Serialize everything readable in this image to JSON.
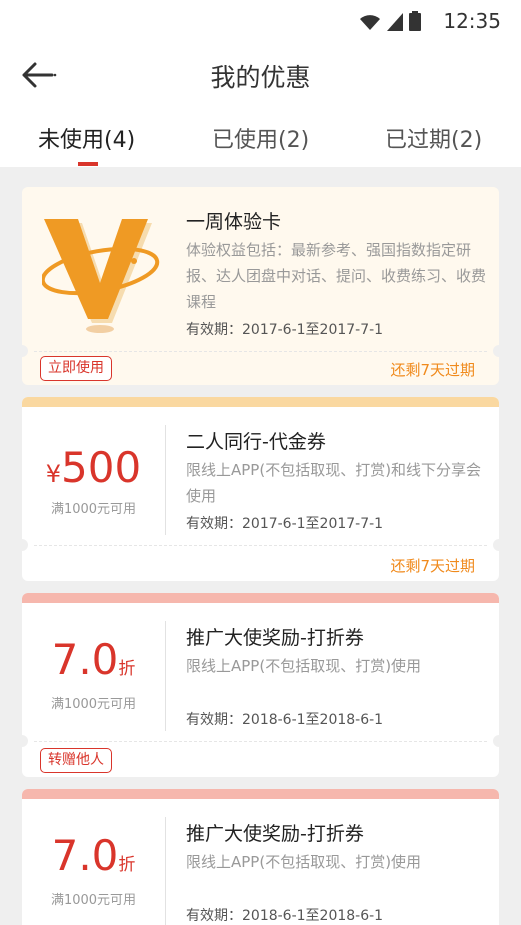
{
  "status_bar": {
    "time": "12:35"
  },
  "header": {
    "title": "我的优惠"
  },
  "tabs": [
    {
      "label": "未使用(4)",
      "active": true
    },
    {
      "label": "已使用(2)",
      "active": false
    },
    {
      "label": "已过期(2)",
      "active": false
    }
  ],
  "colors": {
    "accent": "#d9352b",
    "warning": "#f08a1c",
    "card_top_yellow": "#fad8a0",
    "card_top_pink": "#f6b7ad"
  },
  "coupons": [
    {
      "title": "一周体验卡",
      "description": "体验权益包括：最新参考、强国指数指定研报、达人团盘中对话、提问、收费练习、收费课程",
      "validity": "有效期：2017-6-1至2017-7-1",
      "expire_note": "还剩7天过期",
      "action_label": "立即使用",
      "icon": "v-membership-logo"
    },
    {
      "title": "二人同行-代金券",
      "currency": "¥",
      "amount": "500",
      "condition": "满1000元可用",
      "description": "限线上APP(不包括取现、打赏)和线下分享会使用",
      "validity": "有效期：2017-6-1至2017-7-1",
      "expire_note": "还剩7天过期"
    },
    {
      "title": "推广大使奖励-打折券",
      "amount": "7.0",
      "unit": "折",
      "condition": "满1000元可用",
      "description": "限线上APP(不包括取现、打赏)使用",
      "validity": "有效期：2018-6-1至2018-6-1",
      "action_label": "转赠他人"
    },
    {
      "title": "推广大使奖励-打折券",
      "amount": "7.0",
      "unit": "折",
      "condition": "满1000元可用",
      "description": "限线上APP(不包括取现、打赏)使用",
      "validity": "有效期：2018-6-1至2018-6-1"
    }
  ]
}
